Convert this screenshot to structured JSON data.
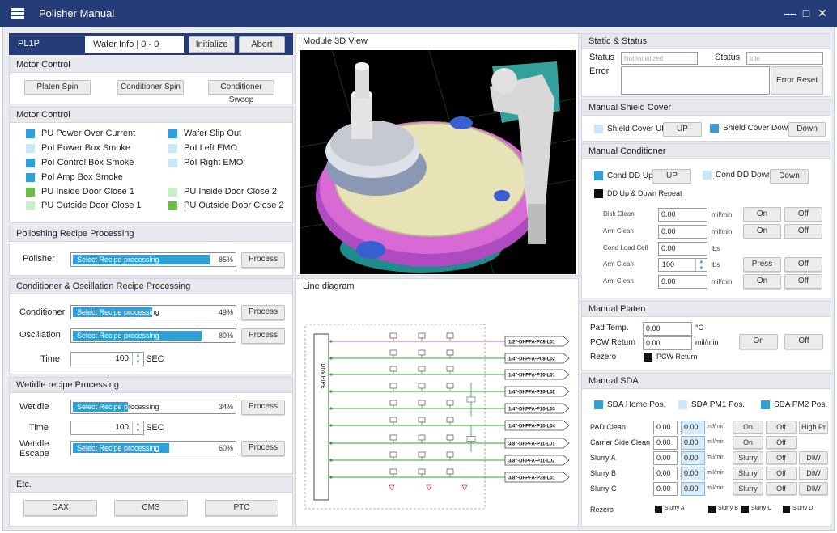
{
  "app": {
    "title": "Polisher Manual"
  },
  "top": {
    "unit": "PL1P",
    "wafer_info": "Wafer Info | 0 - 0",
    "initialize": "Initialize",
    "abort": "Abort"
  },
  "motor_control1": {
    "title": "Motor Control",
    "buttons": [
      "Platen Spin",
      "Conditioner Spin",
      "Conditioner Sweep"
    ]
  },
  "motor_control2": {
    "title": "Motor Control",
    "items": [
      {
        "label": "PU Power Over Current",
        "color": "dark"
      },
      {
        "label": "Wafer Slip Out",
        "color": "dark"
      },
      {
        "label": "PoI Power Box Smoke",
        "color": "light"
      },
      {
        "label": "PoI Left EMO",
        "color": "light"
      },
      {
        "label": "PoI Control Box Smoke",
        "color": "dark"
      },
      {
        "label": "PoI Right EMO",
        "color": "light"
      },
      {
        "label": "PoI Amp Box Smoke",
        "color": "dark"
      },
      {
        "label": "",
        "color": ""
      },
      {
        "label": "PU Inside Door Close 1",
        "color": "green"
      },
      {
        "label": "PU Inside Door Close 2",
        "color": "lgreen"
      },
      {
        "label": "PU Outside Door Close 1",
        "color": "lgreen"
      },
      {
        "label": "PU Outside Door Close 2",
        "color": "green"
      }
    ]
  },
  "polishing": {
    "title": "Polioshing Recipe Processing",
    "label": "Polisher",
    "bar_text": "Select Recipe processing",
    "percent": "85%",
    "progress": 0.85,
    "process": "Process"
  },
  "conditioner": {
    "title": "Conditioner & Oscillation Recipe Processing",
    "cond_label": "Conditioner",
    "cond_bar": "Select Recipe processing",
    "cond_pct": "49%",
    "cond_progress": 0.49,
    "osc_label": "Oscillation",
    "osc_bar": "Select Recipe processing",
    "osc_pct": "80%",
    "osc_progress": 0.8,
    "time_label": "Time",
    "time_value": "100",
    "time_unit": "SEC",
    "process": "Process"
  },
  "wetidle": {
    "title": "Wetidle recipe Processing",
    "w_label": "Wetidle",
    "w_bar": "Select Recipe processing",
    "w_pct": "34%",
    "w_progress": 0.34,
    "time_label": "Time",
    "time_value": "100",
    "time_unit": "SEC",
    "esc_label1": "Wetidle",
    "esc_label2": "Escape",
    "esc_bar": "Select Recipe processing",
    "esc_pct": "60%",
    "esc_progress": 0.6,
    "process": "Process"
  },
  "etc": {
    "title": "Etc.",
    "buttons": [
      "DAX",
      "CMS",
      "PTC"
    ]
  },
  "module3d": {
    "title": "Module 3D View"
  },
  "line": {
    "title": "Line diagram",
    "pipe": "DIW PIPE",
    "lines": [
      "1/2\"-DI-PFA-P08-L01",
      "1/4\"-DI-PFA-P08-L02",
      "1/4\"-DI-PFA-P10-L01",
      "1/4\"-DI-PFA-P10-L02",
      "1/4\"-DI-PFA-P10-L03",
      "1/4\"-DI-PFA-P10-L04",
      "3/8\"-DI-PFA-P11-L01",
      "3/8\"-DI-PFA-P11-L02",
      "3/8\"-DI-PFA-P38-L01"
    ]
  },
  "status": {
    "title": "Static & Status",
    "status_label": "Status",
    "status_value": "Not Initialized",
    "status2_label": "Status",
    "status2_value": "Idle",
    "error_label": "Error",
    "error_reset": "Error Reset"
  },
  "shield": {
    "title": "Manual Shield Cover",
    "up_label": "Shield Cover UP",
    "up_btn": "UP",
    "down_label": "Shield Cover Down",
    "down_btn": "Down"
  },
  "cond": {
    "title": "Manual Conditioner",
    "dd_up": "Cond DD Up",
    "up_btn": "UP",
    "dd_down": "Cond DD Down",
    "down_btn": "Down",
    "repeat": "DD Up & Down Repeat",
    "rows": [
      {
        "label": "Disk Clean",
        "value": "0.00",
        "unit": "mil/min",
        "b1": "On",
        "b2": "Off"
      },
      {
        "label": "Arm Clean",
        "value": "0.00",
        "unit": "mil/min",
        "b1": "On",
        "b2": "Off"
      },
      {
        "label": "Cond Load Cell",
        "value": "0.00",
        "unit": "lbs",
        "b1": "",
        "b2": ""
      },
      {
        "label": "Arm Clean",
        "value": "100",
        "unit": "lbs",
        "b1": "Press",
        "b2": "Off"
      },
      {
        "label": "Arm Clean",
        "value": "0.00",
        "unit": "mil/min",
        "b1": "On",
        "b2": "Off"
      }
    ]
  },
  "platen": {
    "title": "Manual Platen",
    "pad_label": "Pad Temp.",
    "pad_value": "0.00",
    "pad_unit": "°C",
    "pcw_label": "PCW Return",
    "pcw_value": "0.00",
    "pcw_unit": "mil/min",
    "on": "On",
    "off": "Off",
    "rezero": "Rezero",
    "pcw_return": "PCW Return"
  },
  "sda": {
    "title": "Manual SDA",
    "home": "SDA Home Pos.",
    "pm1": "SDA PM1 Pos.",
    "pm2": "SDA PM2 Pos.",
    "rows": [
      {
        "label": "PAD Clean",
        "v1": "0.00",
        "v2": "0.00",
        "unit": "mil/min",
        "b1": "On",
        "b2": "Off",
        "b3": "High Pr"
      },
      {
        "label": "Carrier Side Clean",
        "v1": "0.00",
        "v2": "0.00",
        "unit": "mil/min",
        "b1": "On",
        "b2": "Off",
        "b3": ""
      },
      {
        "label": "Slurry A",
        "v1": "0.00",
        "v2": "0.00",
        "unit": "mil/min",
        "b1": "Slurry",
        "b2": "Off",
        "b3": "DIW"
      },
      {
        "label": "Slurry B",
        "v1": "0.00",
        "v2": "0.00",
        "unit": "mil/min",
        "b1": "Slurry",
        "b2": "Off",
        "b3": "DIW"
      },
      {
        "label": "Slurry C",
        "v1": "0.00",
        "v2": "0.00",
        "unit": "mil/min",
        "b1": "Slurry",
        "b2": "Off",
        "b3": "DIW"
      }
    ],
    "rezero": "Rezero",
    "checks": [
      "Slurry A",
      "Slurry B",
      "Slurry C",
      "Slurry D"
    ]
  }
}
